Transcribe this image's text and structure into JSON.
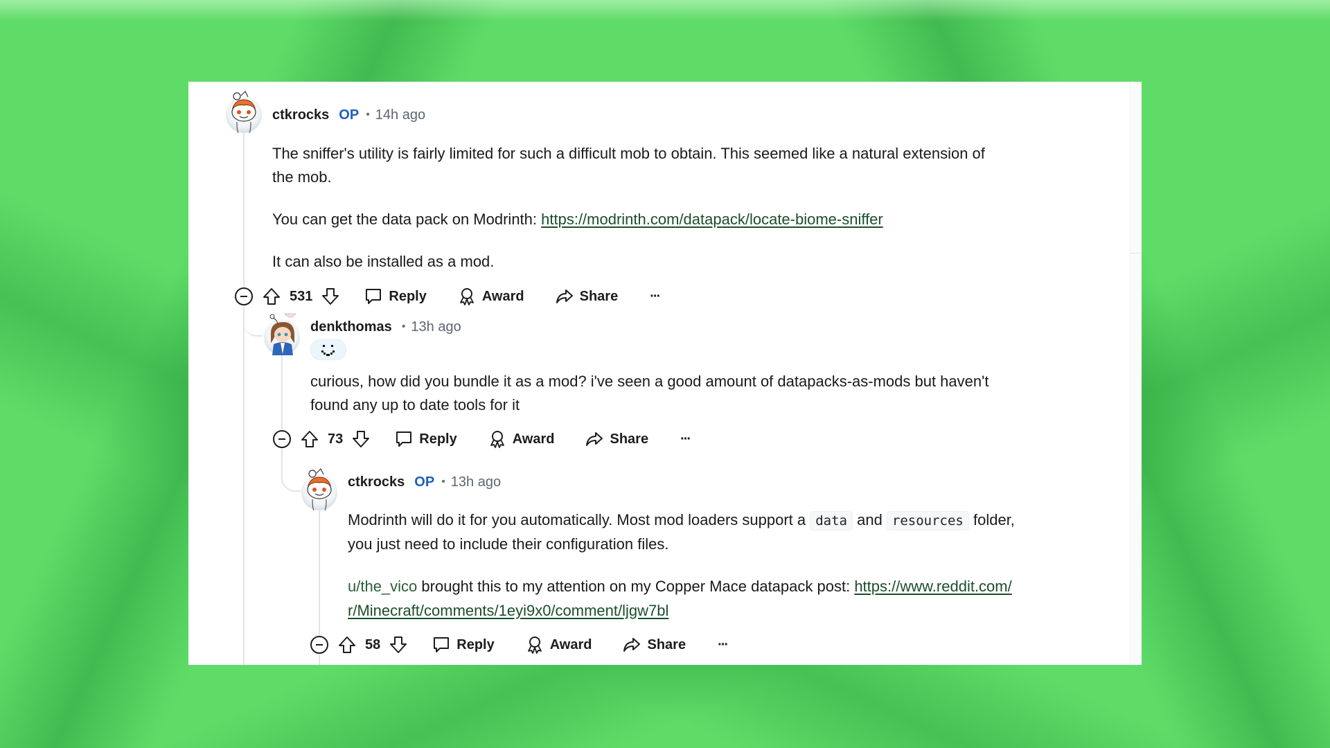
{
  "colors": {
    "background": "#5fdc68",
    "link": "#1b4d2b",
    "op_badge": "#1f5fb8",
    "text": "#1a1a1b",
    "meta": "#5c6670"
  },
  "comments": [
    {
      "username": "ctkrocks",
      "op_label": "OP",
      "separator": "•",
      "time": "14h ago",
      "avatar": "snoo-avatar-orange-hair",
      "body": {
        "line1": "The sniffer's utility is fairly limited for such a difficult mob to obtain. This seemed like a natural extension of",
        "line2": "the mob.",
        "para2_prefix": "You can get the data pack on Modrinth: ",
        "para2_link": "https://modrinth.com/datapack/locate-biome-sniffer",
        "para3": "It can also be installed as a mod."
      },
      "score": "531",
      "actions": {
        "reply": "Reply",
        "award": "Award",
        "share": "Share",
        "more": "···"
      }
    },
    {
      "username": "denkthomas",
      "separator": "•",
      "time": "13h ago",
      "avatar": "anime-girl-avatar",
      "flair": "pixel-smiley-flair",
      "body": {
        "line1": "curious, how did you bundle it as a mod? i've seen a good amount of datapacks-as-mods but haven't",
        "line2": "found any up to date tools for it"
      },
      "score": "73",
      "actions": {
        "reply": "Reply",
        "award": "Award",
        "share": "Share",
        "more": "···"
      }
    },
    {
      "username": "ctkrocks",
      "op_label": "OP",
      "separator": "•",
      "time": "13h ago",
      "avatar": "snoo-avatar-orange-hair",
      "body": {
        "line1_a": "Modrinth will do it for you automatically. Most mod loaders support a ",
        "code1": "data",
        "line1_b": " and ",
        "code2": "resources",
        "line1_c": " folder,",
        "line2": "you just need to include their configuration files.",
        "para2_user_link": "u/the_vico",
        "para2_text": " brought this to my attention on my Copper Mace datapack post: ",
        "para2_link_part1": "https://www.reddit.com/",
        "para2_link_part2": "r/Minecraft/comments/1eyi9x0/comment/ljgw7bl"
      },
      "score": "58",
      "actions": {
        "reply": "Reply",
        "award": "Award",
        "share": "Share",
        "more": "···"
      }
    }
  ]
}
